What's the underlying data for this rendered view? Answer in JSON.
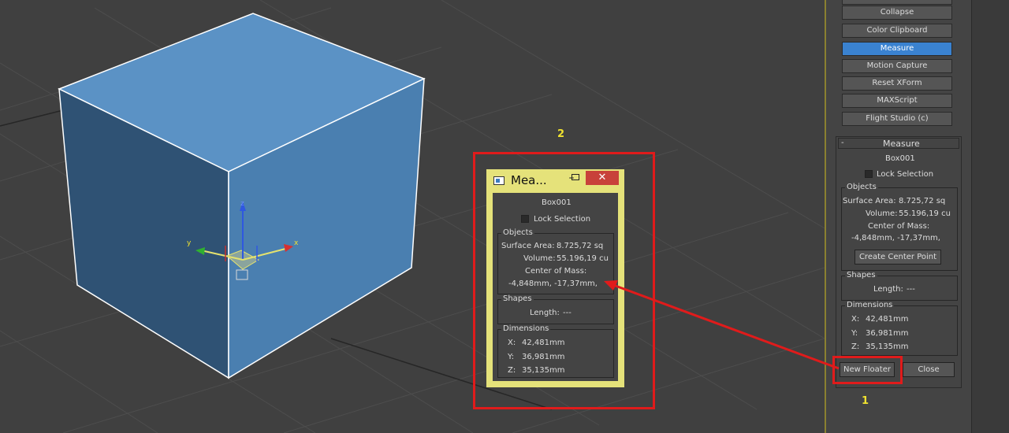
{
  "utilities_buttons": [
    {
      "label": "Collapse",
      "active": false
    },
    {
      "label": "Color Clipboard",
      "active": false
    },
    {
      "label": "Measure",
      "active": true
    },
    {
      "label": "Motion Capture",
      "active": false
    },
    {
      "label": "Reset XForm",
      "active": false
    },
    {
      "label": "MAXScript",
      "active": false
    },
    {
      "label": "Flight Studio (c)",
      "active": false
    }
  ],
  "measure_panel": {
    "collapse_glyph": "-",
    "title": "Measure",
    "object_name": "Box001",
    "lock_selection_label": "Lock Selection",
    "objects_group": "Objects",
    "surface_area_label": "Surface Area:",
    "surface_area_value": "8.725,72 sq",
    "volume_label": "Volume:",
    "volume_value": "55.196,19 cu",
    "center_of_mass_label": "Center of Mass:",
    "center_of_mass_value": "-4,848mm, -17,37mm,",
    "create_center_point_label": "Create Center Point",
    "shapes_group": "Shapes",
    "length_label": "Length:",
    "length_value": "---",
    "dimensions_group": "Dimensions",
    "dim_x_label": "X:",
    "dim_x_value": "42,481mm",
    "dim_y_label": "Y:",
    "dim_y_value": "36,981mm",
    "dim_z_label": "Z:",
    "dim_z_value": "35,135mm",
    "new_floater_label": "New Floater",
    "close_label": "Close"
  },
  "floater": {
    "title": "Mea...",
    "minimize_glyph": "–",
    "close_glyph": "✕",
    "object_name": "Box001",
    "lock_selection_label": "Lock Selection",
    "objects_group": "Objects",
    "surface_area_label": "Surface Area:",
    "surface_area_value": "8.725,72 sq",
    "volume_label": "Volume:",
    "volume_value": "55.196,19 cu",
    "center_of_mass_label": "Center of Mass:",
    "center_of_mass_value": "-4,848mm, -17,37mm,",
    "shapes_group": "Shapes",
    "length_label": "Length:",
    "length_value": "---",
    "dimensions_group": "Dimensions",
    "dim_x_label": "X:",
    "dim_x_value": "42,481mm",
    "dim_y_label": "Y:",
    "dim_y_value": "36,981mm",
    "dim_z_label": "Z:",
    "dim_z_value": "35,135mm"
  },
  "gizmo": {
    "x_label": "x",
    "y_label": "y",
    "z_label": "z"
  },
  "annotations": {
    "step1": "1",
    "step2": "2"
  },
  "colors": {
    "cube_front": "#4a7fb0",
    "cube_top": "#5b92c5",
    "cube_side": "#2e4f6e",
    "annotation_red": "#e01b1b",
    "annotation_yellow": "#f0e230",
    "active_button": "#3a82d0"
  }
}
